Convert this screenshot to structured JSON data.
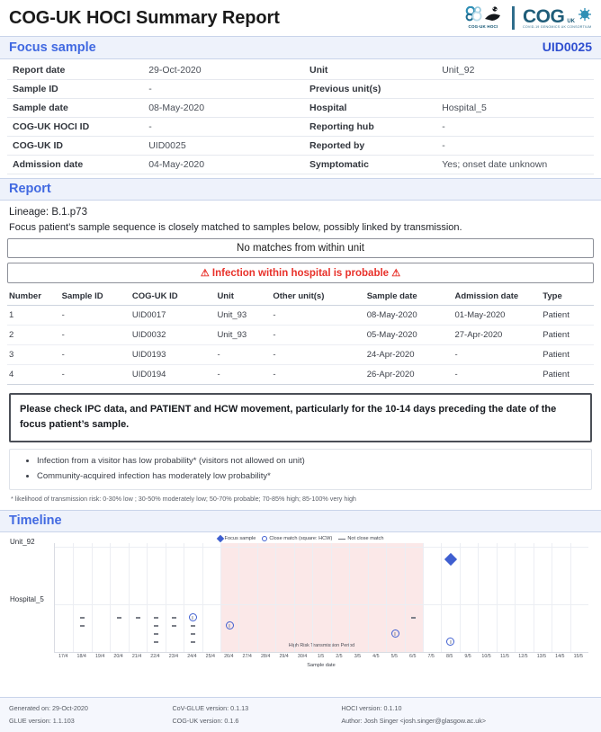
{
  "header": {
    "title": "COG-UK HOCI Summary Report",
    "logo_hoci_caption": "COG-UK HOCI",
    "logo_cog_word": "COG",
    "logo_cog_uk": "UK",
    "logo_cog_sub": "COVID-19 GENOMICS UK CONSORTIUM"
  },
  "focus_sample": {
    "section_title": "Focus sample",
    "uid": "UID0025",
    "left_rows": [
      {
        "key": "Report date",
        "value": "29-Oct-2020"
      },
      {
        "key": "Sample ID",
        "value": "-"
      },
      {
        "key": "Sample date",
        "value": "08-May-2020"
      },
      {
        "key": "COG-UK HOCI ID",
        "value": "-"
      },
      {
        "key": "COG-UK ID",
        "value": "UID0025"
      },
      {
        "key": "Admission date",
        "value": "04-May-2020"
      }
    ],
    "right_rows": [
      {
        "key": "Unit",
        "value": "Unit_92"
      },
      {
        "key": "Previous unit(s)",
        "value": ""
      },
      {
        "key": "Hospital",
        "value": "Hospital_5"
      },
      {
        "key": "Reporting hub",
        "value": "-"
      },
      {
        "key": "Reported by",
        "value": "-"
      },
      {
        "key": "Symptomatic",
        "value": "Yes; onset date unknown"
      }
    ]
  },
  "report": {
    "section_title": "Report",
    "lineage": "Lineage: B.1.p73",
    "lead_text": "Focus patient’s sample sequence is closely matched to samples below, possibly linked by transmission.",
    "banner_no_matches": "No matches from within unit",
    "banner_warning": "Infection within hospital is probable",
    "warning_icon": "⚠",
    "table": {
      "headers": [
        "Number",
        "Sample ID",
        "COG-UK ID",
        "Unit",
        "Other unit(s)",
        "Sample date",
        "Admission date",
        "Type"
      ],
      "rows": [
        [
          "1",
          "-",
          "UID0017",
          "Unit_93",
          "-",
          "08-May-2020",
          "01-May-2020",
          "Patient"
        ],
        [
          "2",
          "-",
          "UID0032",
          "Unit_93",
          "-",
          "05-May-2020",
          "27-Apr-2020",
          "Patient"
        ],
        [
          "3",
          "-",
          "UID0193",
          "-",
          "-",
          "24-Apr-2020",
          "-",
          "Patient"
        ],
        [
          "4",
          "-",
          "UID0194",
          "-",
          "-",
          "26-Apr-2020",
          "-",
          "Patient"
        ]
      ]
    },
    "advisory": "Please check IPC data, and PATIENT and HCW movement, particularly for the 10-14 days preceding the date of the focus patient’s sample.",
    "probabilities": [
      "Infection from a visitor has low probability* (visitors not allowed on unit)",
      "Community-acquired infection has moderately low probability*"
    ],
    "footnote": "* likelihood of transmission risk: 0-30% low ; 30-50% moderately low; 50-70% probable; 70-85% high; 85-100% very high"
  },
  "timeline": {
    "section_title": "Timeline",
    "legend": [
      {
        "marker": "diamond",
        "label": "Focus sample"
      },
      {
        "marker": "circle",
        "label": "Close match (square: HCW)"
      },
      {
        "marker": "dash",
        "label": "Not close match"
      }
    ],
    "risk_band_label": "High Risk Transmission Period",
    "xaxis_label": "Sample date"
  },
  "chart_data": {
    "type": "scatter",
    "title": "Timeline",
    "xlabel": "Sample date",
    "ylabel": "",
    "grid": true,
    "legend_position": "top-center",
    "categories": [
      "Unit_92",
      "Hospital_5"
    ],
    "x_ticks": [
      "17/4",
      "18/4",
      "19/4",
      "20/4",
      "21/4",
      "22/4",
      "23/4",
      "24/4",
      "25/4",
      "26/4",
      "27/4",
      "28/4",
      "29/4",
      "30/4",
      "1/5",
      "2/5",
      "3/5",
      "4/5",
      "5/5",
      "6/5",
      "7/5",
      "8/5",
      "9/5",
      "10/5",
      "11/5",
      "12/5",
      "13/5",
      "14/5",
      "15/5"
    ],
    "xlim": [
      "17/4",
      "15/5"
    ],
    "risk_band": {
      "start": "26/4",
      "end": "6/5",
      "label": "High Risk Transmission Period"
    },
    "series": [
      {
        "name": "Focus sample",
        "marker": "diamond",
        "color": "#3f5fd0",
        "points": [
          {
            "row": "Unit_92",
            "x": "8/5",
            "stack": 0
          }
        ]
      },
      {
        "name": "Close match (square: HCW)",
        "marker": "circle",
        "color": "#3f5fd0",
        "points": [
          {
            "row": "Hospital_5",
            "x": "24/4",
            "stack": 0
          },
          {
            "row": "Hospital_5",
            "x": "26/4",
            "stack": 0
          },
          {
            "row": "Hospital_5",
            "x": "5/5",
            "stack": 0
          },
          {
            "row": "Hospital_5",
            "x": "8/5",
            "stack": 0
          }
        ]
      },
      {
        "name": "Not close match",
        "marker": "dash",
        "color": "#7b7f88",
        "points": [
          {
            "row": "Hospital_5",
            "x": "18/4",
            "stack": 0
          },
          {
            "row": "Hospital_5",
            "x": "18/4",
            "stack": 1
          },
          {
            "row": "Hospital_5",
            "x": "20/4",
            "stack": 0
          },
          {
            "row": "Hospital_5",
            "x": "21/4",
            "stack": 0
          },
          {
            "row": "Hospital_5",
            "x": "22/4",
            "stack": 0
          },
          {
            "row": "Hospital_5",
            "x": "22/4",
            "stack": 1
          },
          {
            "row": "Hospital_5",
            "x": "22/4",
            "stack": 2
          },
          {
            "row": "Hospital_5",
            "x": "22/4",
            "stack": 3
          },
          {
            "row": "Hospital_5",
            "x": "23/4",
            "stack": 0
          },
          {
            "row": "Hospital_5",
            "x": "23/4",
            "stack": 1
          },
          {
            "row": "Hospital_5",
            "x": "24/4",
            "stack": 1
          },
          {
            "row": "Hospital_5",
            "x": "24/4",
            "stack": 2
          },
          {
            "row": "Hospital_5",
            "x": "24/4",
            "stack": 3
          },
          {
            "row": "Hospital_5",
            "x": "6/5",
            "stack": 0
          }
        ]
      }
    ]
  },
  "footer": {
    "col1": [
      "Generated on: 29-Oct-2020",
      "GLUE version: 1.1.103"
    ],
    "col2": [
      "CoV-GLUE version: 0.1.13",
      "COG-UK version: 0.1.6"
    ],
    "col3": [
      "HOCI version: 0.1.10",
      "Author: Josh Singer <josh.singer@glasgow.ac.uk>"
    ]
  }
}
